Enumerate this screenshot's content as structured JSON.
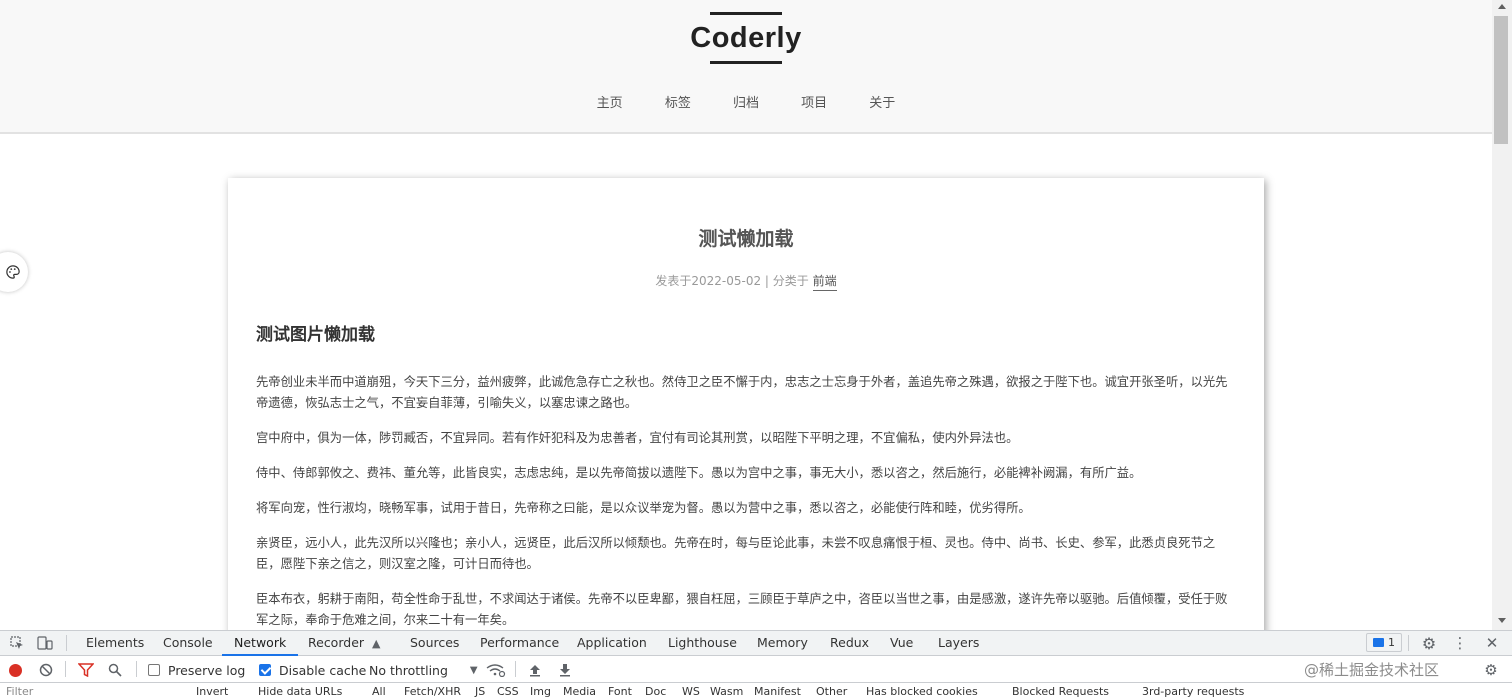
{
  "site": {
    "logo": "Coderly",
    "nav": [
      "主页",
      "标签",
      "归档",
      "项目",
      "关于"
    ]
  },
  "post": {
    "title": "测试懒加载",
    "meta_prefix": "发表于2022-05-02 | 分类于",
    "category": "前端",
    "heading": "测试图片懒加载",
    "paragraphs": [
      "先帝创业未半而中道崩殂，今天下三分，益州疲弊，此诚危急存亡之秋也。然侍卫之臣不懈于内，忠志之士忘身于外者，盖追先帝之殊遇，欲报之于陛下也。诚宜开张圣听，以光先帝遗德，恢弘志士之气，不宜妄自菲薄，引喻失义，以塞忠谏之路也。",
      "宫中府中，俱为一体，陟罚臧否，不宜异同。若有作奸犯科及为忠善者，宜付有司论其刑赏，以昭陛下平明之理，不宜偏私，使内外异法也。",
      "侍中、侍郎郭攸之、费祎、董允等，此皆良实，志虑忠纯，是以先帝简拔以遗陛下。愚以为宫中之事，事无大小，悉以咨之，然后施行，必能裨补阙漏，有所广益。",
      "将军向宠，性行淑均，晓畅军事，试用于昔日，先帝称之曰能，是以众议举宠为督。愚以为营中之事，悉以咨之，必能使行阵和睦，优劣得所。",
      "亲贤臣，远小人，此先汉所以兴隆也；亲小人，远贤臣，此后汉所以倾颓也。先帝在时，每与臣论此事，未尝不叹息痛恨于桓、灵也。侍中、尚书、长史、参军，此悉贞良死节之臣，愿陛下亲之信之，则汉室之隆，可计日而待也。",
      "臣本布衣，躬耕于南阳，苟全性命于乱世，不求闻达于诸侯。先帝不以臣卑鄙，猥自枉屈，三顾臣于草庐之中，咨臣以当世之事，由是感激，遂许先帝以驱驰。后值倾覆，受任于败军之际，奉命于危难之间，尔来二十有一年矣。"
    ]
  },
  "devtools": {
    "tabs": [
      "Elements",
      "Console",
      "Network",
      "Recorder",
      "Sources",
      "Performance",
      "Application",
      "Lighthouse",
      "Memory",
      "Redux",
      "Vue",
      "Layers"
    ],
    "active_tab": "Network",
    "issues_count": "1",
    "preserve_log": "Preserve log",
    "disable_cache": "Disable cache",
    "throttling": "No throttling",
    "filter_row": [
      "Filter",
      "Invert",
      "Hide data URLs",
      "All",
      "Fetch/XHR",
      "JS",
      "CSS",
      "Img",
      "Media",
      "Font",
      "Doc",
      "WS",
      "Wasm",
      "Manifest",
      "Other",
      "Has blocked cookies",
      "Blocked Requests",
      "3rd-party requests"
    ]
  },
  "watermark": "@稀土掘金技术社区",
  "colors": {
    "accent": "#1a73e8",
    "record": "#d93025",
    "filter": "#d93025"
  }
}
